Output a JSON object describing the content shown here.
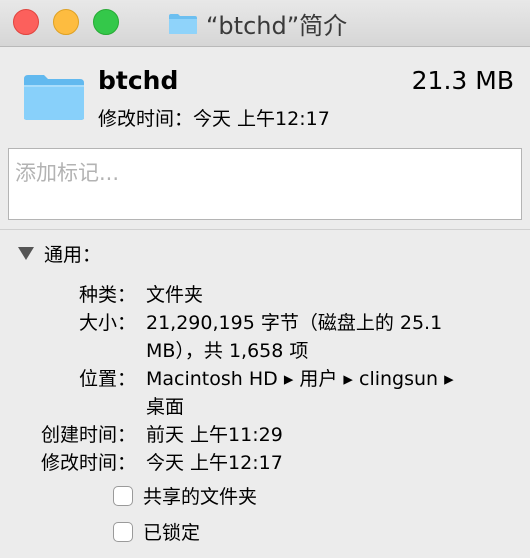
{
  "window": {
    "title": "“btchd”简介"
  },
  "header": {
    "name": "btchd",
    "size": "21.3 MB",
    "modified": "修改时间：今天 上午12:17"
  },
  "tags": {
    "placeholder": "添加标记..."
  },
  "general": {
    "title": "通用：",
    "kind_label": "种类：",
    "kind": "文件夹",
    "size_label": "大小：",
    "size_line1": "21,290,195 字节（磁盘上的 25.1",
    "size_line2": "MB），共 1,658 项",
    "where_label": "位置：",
    "where_line1": "Macintosh HD ▸ 用户 ▸ clingsun ▸",
    "where_line2": "桌面",
    "created_label": "创建时间：",
    "created": "前天 上午11:29",
    "modified_label": "修改时间：",
    "modified": "今天 上午12:17",
    "shared_folder": "共享的文件夹",
    "locked": "已锁定"
  },
  "colors": {
    "folder": "#7cc8f5",
    "close": "#fc605c",
    "minimize": "#fdbc40",
    "zoom": "#34c84a"
  }
}
